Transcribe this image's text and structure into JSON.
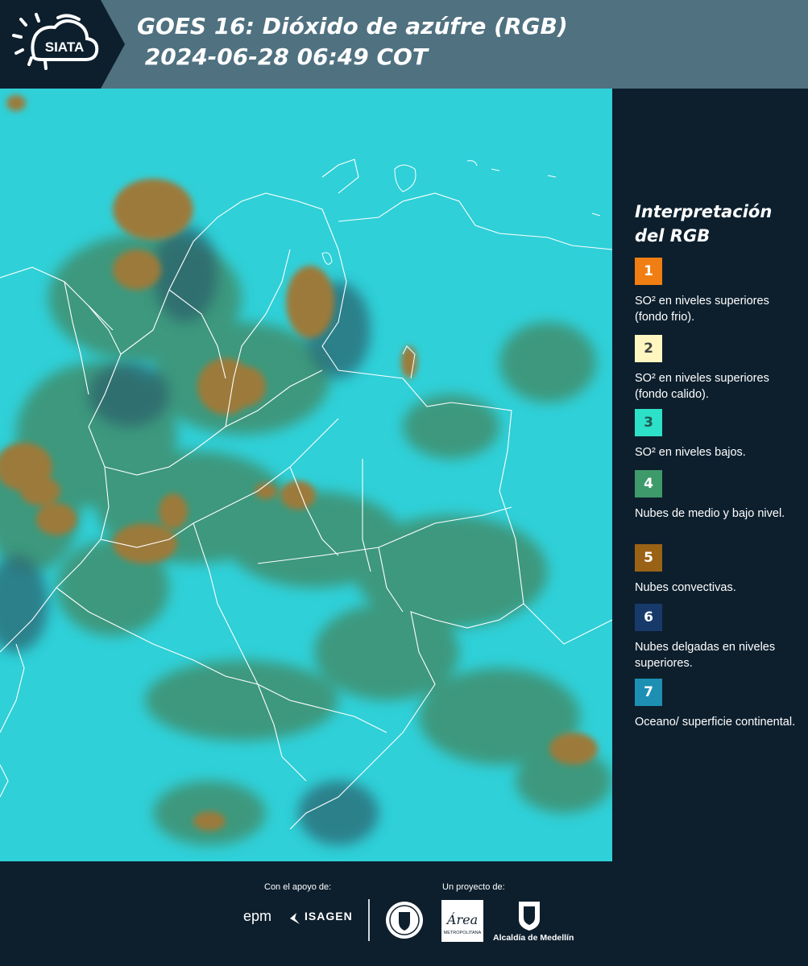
{
  "header": {
    "logo_text": "SIATA",
    "title_line1": "GOES 16: Dióxido de azúfre (RGB)",
    "title_line2": " 2024-06-28 06:49 COT"
  },
  "map": {
    "background_color": "#2fd0d8",
    "cloud_colors": {
      "convective": "#9c7a3a",
      "mid_low": "#3f8f6e",
      "thin_high": "#2a5f6a"
    },
    "border_color": "#ffffff"
  },
  "legend": {
    "title": "Interpretación del RGB",
    "items": [
      {
        "number": "1",
        "color": "#f07e12",
        "number_color": "#ffffff",
        "text": "SO² en niveles superiores (fondo frio)."
      },
      {
        "number": "2",
        "color": "#fff7bf",
        "number_color": "#444444",
        "text": "SO² en niveles superiores (fondo calido)."
      },
      {
        "number": "3",
        "color": "#2de0c8",
        "number_color": "#1d5a52",
        "text": "SO² en niveles bajos."
      },
      {
        "number": "4",
        "color": "#3e9a6a",
        "number_color": "#ffffff",
        "text": "Nubes de medio y bajo nivel."
      },
      {
        "number": "5",
        "color": "#9a6215",
        "number_color": "#ffffff",
        "text": "Nubes convectivas."
      },
      {
        "number": "6",
        "color": "#173a6b",
        "number_color": "#ffffff",
        "text": "Nubes delgadas en niveles superiores."
      },
      {
        "number": "7",
        "color": "#1c8fb3",
        "number_color": "#ffffff",
        "text": "Oceano/ superficie continental."
      }
    ]
  },
  "footer": {
    "support_label": "Con el apoyo de:",
    "project_label": "Un proyecto de:",
    "epm": "epm",
    "isagen": "ISAGEN",
    "area_logo_text": "Área",
    "area_sub": "METROPOLITANA",
    "alcaldia": "Alcaldía de Medellín"
  }
}
